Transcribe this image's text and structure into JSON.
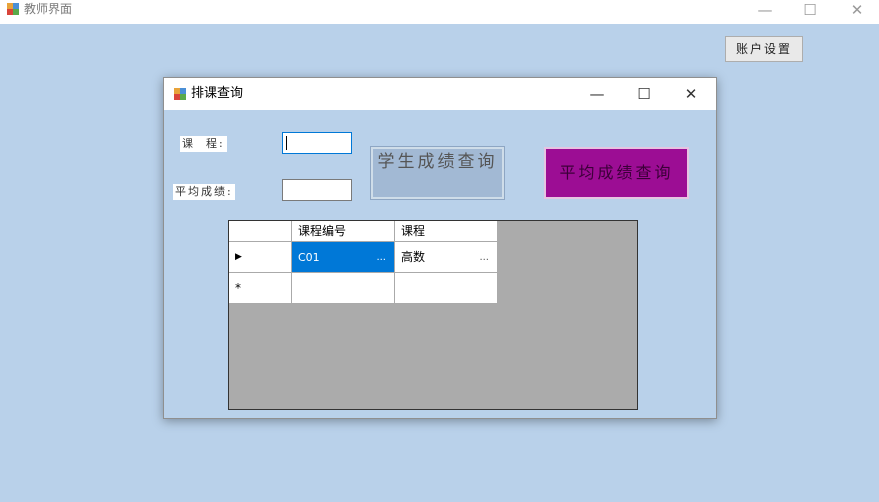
{
  "window": {
    "title": "教师界面",
    "minimize": "—",
    "maximize": "☐",
    "close": "✕"
  },
  "account_button": "账户设置",
  "dialog": {
    "title": "排课查询",
    "minimize": "—",
    "maximize": "☐",
    "close": "✕",
    "course_label": "课  程:",
    "avg_label": "平均成绩:",
    "course_value": "",
    "avg_value": "",
    "student_query_button": "学生成绩查询",
    "avg_query_button": "平均成绩查询",
    "grid": {
      "columns": [
        "课程编号",
        "课程"
      ],
      "rows": [
        {
          "indicator": "▶",
          "cells": [
            "C01",
            "高数"
          ]
        },
        {
          "indicator": "*",
          "cells": [
            "",
            ""
          ]
        }
      ],
      "ellipsis": "..."
    }
  },
  "colors": {
    "background": "#b9d1ea",
    "accent": "#0078d7",
    "avg_button": "#9c0d94"
  }
}
